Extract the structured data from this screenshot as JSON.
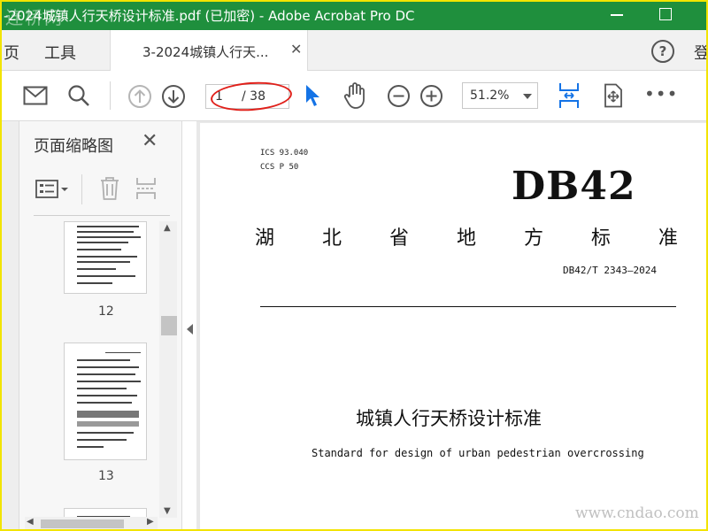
{
  "window": {
    "title": "-2024城镇人行天桥设计标准.pdf (已加密) - Adobe Acrobat Pro DC",
    "watermark_top": "连桥网"
  },
  "tabs": {
    "home": "页",
    "tools": "工具",
    "doc_tab": "3-2024城镇人行天...",
    "login": "登"
  },
  "toolbar": {
    "current_page": "1",
    "total_pages": "/ 38",
    "zoom": "51.2%",
    "accent": "#1473e6",
    "annotation_color": "#e0201a"
  },
  "sidebar": {
    "title": "页面缩略图",
    "thumbnails": [
      {
        "page": "12"
      },
      {
        "page": "13"
      }
    ]
  },
  "document": {
    "ics": "ICS  93.040",
    "ccs": "CCS  P 50",
    "code": "DB42",
    "province_chars": [
      "湖",
      "北",
      "省",
      "地",
      "方",
      "标",
      "准"
    ],
    "standard_number": "DB42/T 2343—2024",
    "title_cn": "城镇人行天桥设计标准",
    "title_en": "Standard for design of urban pedestrian overcrossing"
  },
  "watermark_bottom": "www.cndao.com"
}
